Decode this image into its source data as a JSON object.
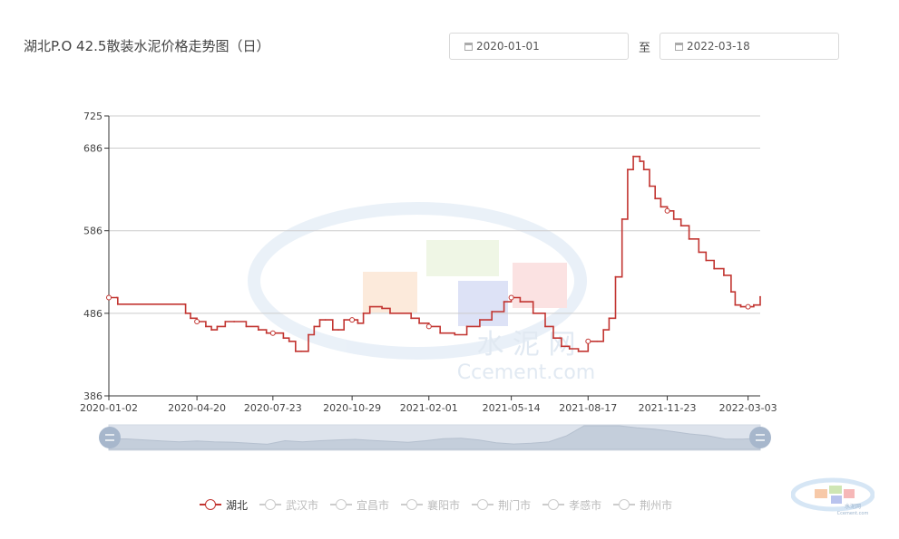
{
  "header": {
    "title": "湖北P.O 42.5散装水泥价格走势图（日）",
    "date_start": "2020-01-01",
    "date_to_label": "至",
    "date_end": "2022-03-18"
  },
  "watermark": {
    "cn": "水 泥 网",
    "en": "Ccement.com"
  },
  "logo": {
    "cn": "水泥网",
    "en": "Ccement.com"
  },
  "colors": {
    "series": "#c23531",
    "axis": "#333333",
    "grid": "#cccccc",
    "inactive": "#cccccc",
    "slider": "#a7b7cc"
  },
  "legend": {
    "items": [
      {
        "label": "湖北",
        "active": true
      },
      {
        "label": "武汉市",
        "active": false
      },
      {
        "label": "宜昌市",
        "active": false
      },
      {
        "label": "襄阳市",
        "active": false
      },
      {
        "label": "荆门市",
        "active": false
      },
      {
        "label": "孝感市",
        "active": false
      },
      {
        "label": "荆州市",
        "active": false
      }
    ]
  },
  "chart_data": {
    "type": "line",
    "title": "湖北P.O 42.5散装水泥价格走势图（日）",
    "xlabel": "",
    "ylabel": "",
    "ylim": [
      386,
      725
    ],
    "yticks": [
      386,
      486,
      586,
      686,
      725
    ],
    "xticks": [
      "2020-01-02",
      "2020-04-20",
      "2020-07-23",
      "2020-10-29",
      "2021-02-01",
      "2021-05-14",
      "2021-08-17",
      "2021-11-23",
      "2022-03-03"
    ],
    "xlim": [
      "2020-01-02",
      "2022-03-18"
    ],
    "grid": true,
    "legend_position": "bottom",
    "series": [
      {
        "name": "湖北",
        "x": [
          "2020-01-02",
          "2020-01-12",
          "2020-01-13",
          "2020-04-05",
          "2020-04-06",
          "2020-04-12",
          "2020-04-20",
          "2020-05-01",
          "2020-05-08",
          "2020-05-15",
          "2020-05-25",
          "2020-06-05",
          "2020-06-20",
          "2020-07-05",
          "2020-07-15",
          "2020-07-23",
          "2020-08-05",
          "2020-08-12",
          "2020-08-20",
          "2020-08-27",
          "2020-09-05",
          "2020-09-12",
          "2020-09-19",
          "2020-09-26",
          "2020-10-05",
          "2020-10-12",
          "2020-10-19",
          "2020-10-29",
          "2020-11-05",
          "2020-11-12",
          "2020-11-20",
          "2020-12-05",
          "2020-12-15",
          "2021-01-10",
          "2021-01-20",
          "2021-02-01",
          "2021-02-15",
          "2021-03-05",
          "2021-03-20",
          "2021-04-05",
          "2021-04-20",
          "2021-05-05",
          "2021-05-14",
          "2021-05-25",
          "2021-06-10",
          "2021-06-25",
          "2021-07-05",
          "2021-07-15",
          "2021-07-25",
          "2021-08-05",
          "2021-08-17",
          "2021-08-28",
          "2021-09-05",
          "2021-09-12",
          "2021-09-20",
          "2021-09-28",
          "2021-10-05",
          "2021-10-12",
          "2021-10-20",
          "2021-10-25",
          "2021-11-01",
          "2021-11-08",
          "2021-11-15",
          "2021-11-23",
          "2021-12-01",
          "2021-12-10",
          "2021-12-20",
          "2022-01-01",
          "2022-01-10",
          "2022-01-20",
          "2022-02-01",
          "2022-02-10",
          "2022-02-15",
          "2022-02-22",
          "2022-03-03",
          "2022-03-10",
          "2022-03-18"
        ],
        "values": [
          505,
          505,
          497,
          497,
          486,
          480,
          476,
          470,
          466,
          470,
          476,
          476,
          470,
          466,
          462,
          462,
          456,
          452,
          440,
          440,
          460,
          470,
          478,
          478,
          466,
          466,
          478,
          478,
          474,
          486,
          494,
          492,
          486,
          480,
          474,
          470,
          462,
          460,
          470,
          478,
          488,
          500,
          505,
          500,
          486,
          470,
          456,
          446,
          443,
          440,
          452,
          452,
          466,
          480,
          530,
          600,
          660,
          676,
          670,
          660,
          640,
          625,
          615,
          610,
          600,
          592,
          576,
          560,
          550,
          540,
          532,
          512,
          496,
          494,
          494,
          496,
          506
        ]
      }
    ],
    "overview": {
      "values": [
        497,
        497,
        486,
        476,
        466,
        476,
        466,
        462,
        452,
        440,
        478,
        466,
        478,
        486,
        492,
        480,
        470,
        460,
        478,
        500,
        505,
        486,
        456,
        443,
        452,
        466,
        530,
        660,
        676,
        640,
        615,
        600,
        576,
        550,
        532,
        496,
        494,
        506
      ]
    }
  }
}
